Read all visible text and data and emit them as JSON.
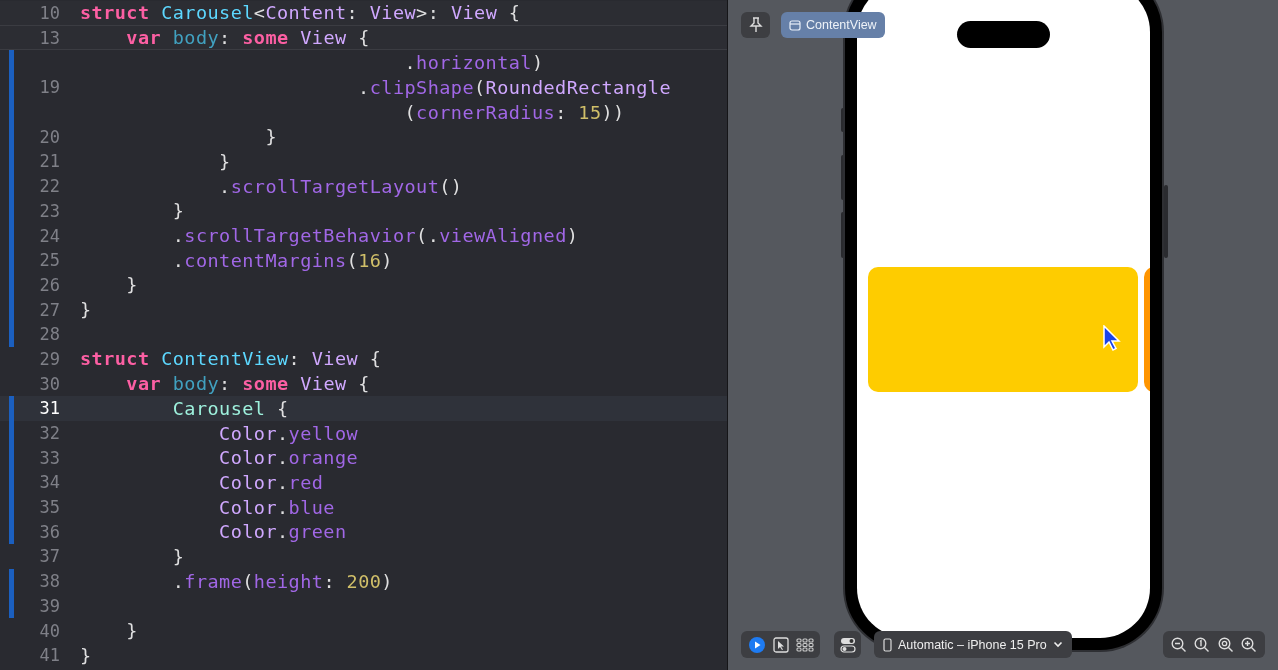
{
  "editor": {
    "lines": [
      {
        "number": "10",
        "sticky": true,
        "current": false,
        "changed": false,
        "tokens": [
          {
            "kind": "kw",
            "text": "struct "
          },
          {
            "kind": "decl",
            "text": "Carousel"
          },
          {
            "kind": "plain",
            "text": "<"
          },
          {
            "kind": "type",
            "text": "Content"
          },
          {
            "kind": "plain",
            "text": ": "
          },
          {
            "kind": "type",
            "text": "View"
          },
          {
            "kind": "plain",
            "text": ">: "
          },
          {
            "kind": "type",
            "text": "View"
          },
          {
            "kind": "plain",
            "text": " {"
          }
        ]
      },
      {
        "number": "13",
        "sticky": true,
        "current": false,
        "changed": false,
        "tokens": [
          {
            "kind": "kw",
            "text": "    var"
          },
          {
            "kind": "prop",
            "text": " body"
          },
          {
            "kind": "plain",
            "text": ": "
          },
          {
            "kind": "kw",
            "text": "some"
          },
          {
            "kind": "type",
            "text": " View"
          },
          {
            "kind": "plain",
            "text": " {"
          }
        ]
      },
      {
        "sticky": false,
        "current": false,
        "changed": true,
        "tokens": [
          {
            "kind": "plain",
            "text": "                            ."
          },
          {
            "kind": "method",
            "text": "horizontal"
          },
          {
            "kind": "plain",
            "text": ")"
          }
        ]
      },
      {
        "number": "19",
        "sticky": false,
        "current": false,
        "changed": true,
        "tokens": [
          {
            "kind": "plain",
            "text": "                        ."
          },
          {
            "kind": "method",
            "text": "clipShape"
          },
          {
            "kind": "plain",
            "text": "("
          },
          {
            "kind": "type",
            "text": "RoundedRectangle"
          }
        ]
      },
      {
        "sticky": false,
        "current": false,
        "changed": true,
        "tokens": [
          {
            "kind": "plain",
            "text": "                            ("
          },
          {
            "kind": "method",
            "text": "cornerRadius"
          },
          {
            "kind": "plain",
            "text": ": "
          },
          {
            "kind": "num",
            "text": "15"
          },
          {
            "kind": "plain",
            "text": "))"
          }
        ]
      },
      {
        "number": "20",
        "sticky": false,
        "current": false,
        "changed": true,
        "tokens": [
          {
            "kind": "plain",
            "text": "                }"
          }
        ]
      },
      {
        "number": "21",
        "sticky": false,
        "current": false,
        "changed": true,
        "tokens": [
          {
            "kind": "plain",
            "text": "            }"
          }
        ]
      },
      {
        "number": "22",
        "sticky": false,
        "current": false,
        "changed": true,
        "tokens": [
          {
            "kind": "plain",
            "text": "            ."
          },
          {
            "kind": "method",
            "text": "scrollTargetLayout"
          },
          {
            "kind": "plain",
            "text": "()"
          }
        ]
      },
      {
        "number": "23",
        "sticky": false,
        "current": false,
        "changed": true,
        "tokens": [
          {
            "kind": "plain",
            "text": "        }"
          }
        ]
      },
      {
        "number": "24",
        "sticky": false,
        "current": false,
        "changed": true,
        "tokens": [
          {
            "kind": "plain",
            "text": "        ."
          },
          {
            "kind": "method",
            "text": "scrollTargetBehavior"
          },
          {
            "kind": "plain",
            "text": "(."
          },
          {
            "kind": "method",
            "text": "viewAligned"
          },
          {
            "kind": "plain",
            "text": ")"
          }
        ]
      },
      {
        "number": "25",
        "sticky": false,
        "current": false,
        "changed": true,
        "tokens": [
          {
            "kind": "plain",
            "text": "        ."
          },
          {
            "kind": "method",
            "text": "contentMargins"
          },
          {
            "kind": "plain",
            "text": "("
          },
          {
            "kind": "num",
            "text": "16"
          },
          {
            "kind": "plain",
            "text": ")"
          }
        ]
      },
      {
        "number": "26",
        "sticky": false,
        "current": false,
        "changed": true,
        "tokens": [
          {
            "kind": "plain",
            "text": "    }"
          }
        ]
      },
      {
        "number": "27",
        "sticky": false,
        "current": false,
        "changed": true,
        "tokens": [
          {
            "kind": "plain",
            "text": "}"
          }
        ]
      },
      {
        "number": "28",
        "sticky": false,
        "current": false,
        "changed": true
      },
      {
        "number": "29",
        "sticky": false,
        "current": false,
        "changed": false,
        "tokens": [
          {
            "kind": "kw",
            "text": "struct "
          },
          {
            "kind": "decl",
            "text": "ContentView"
          },
          {
            "kind": "plain",
            "text": ": "
          },
          {
            "kind": "type",
            "text": "View"
          },
          {
            "kind": "plain",
            "text": " {"
          }
        ]
      },
      {
        "number": "30",
        "sticky": false,
        "current": false,
        "changed": false,
        "tokens": [
          {
            "kind": "kw",
            "text": "    var"
          },
          {
            "kind": "prop",
            "text": " body"
          },
          {
            "kind": "plain",
            "text": ": "
          },
          {
            "kind": "kw",
            "text": "some"
          },
          {
            "kind": "type",
            "text": " View"
          },
          {
            "kind": "plain",
            "text": " {"
          }
        ]
      },
      {
        "number": "31",
        "sticky": false,
        "current": true,
        "changed": true,
        "tokens": [
          {
            "kind": "projtype",
            "text": "        Carousel"
          },
          {
            "kind": "plain",
            "text": " {"
          }
        ]
      },
      {
        "number": "32",
        "sticky": false,
        "current": false,
        "changed": true,
        "tokens": [
          {
            "kind": "type",
            "text": "            Color"
          },
          {
            "kind": "plain",
            "text": "."
          },
          {
            "kind": "method",
            "text": "yellow"
          }
        ]
      },
      {
        "number": "33",
        "sticky": false,
        "current": false,
        "changed": true,
        "tokens": [
          {
            "kind": "type",
            "text": "            Color"
          },
          {
            "kind": "plain",
            "text": "."
          },
          {
            "kind": "method",
            "text": "orange"
          }
        ]
      },
      {
        "number": "34",
        "sticky": false,
        "current": false,
        "changed": true,
        "tokens": [
          {
            "kind": "type",
            "text": "            Color"
          },
          {
            "kind": "plain",
            "text": "."
          },
          {
            "kind": "method",
            "text": "red"
          }
        ]
      },
      {
        "number": "35",
        "sticky": false,
        "current": false,
        "changed": true,
        "tokens": [
          {
            "kind": "type",
            "text": "            Color"
          },
          {
            "kind": "plain",
            "text": "."
          },
          {
            "kind": "method",
            "text": "blue"
          }
        ]
      },
      {
        "number": "36",
        "sticky": false,
        "current": false,
        "changed": true,
        "tokens": [
          {
            "kind": "type",
            "text": "            Color"
          },
          {
            "kind": "plain",
            "text": "."
          },
          {
            "kind": "method",
            "text": "green"
          }
        ]
      },
      {
        "number": "37",
        "sticky": false,
        "current": false,
        "changed": false,
        "tokens": [
          {
            "kind": "plain",
            "text": "        }"
          }
        ]
      },
      {
        "number": "38",
        "sticky": false,
        "current": false,
        "changed": true,
        "tokens": [
          {
            "kind": "plain",
            "text": "        ."
          },
          {
            "kind": "method",
            "text": "frame"
          },
          {
            "kind": "plain",
            "text": "("
          },
          {
            "kind": "method",
            "text": "height"
          },
          {
            "kind": "plain",
            "text": ": "
          },
          {
            "kind": "num",
            "text": "200"
          },
          {
            "kind": "plain",
            "text": ")"
          }
        ]
      },
      {
        "number": "39",
        "sticky": false,
        "current": false,
        "changed": true
      },
      {
        "number": "40",
        "sticky": false,
        "current": false,
        "changed": false,
        "tokens": [
          {
            "kind": "plain",
            "text": "    }"
          }
        ]
      },
      {
        "number": "41",
        "sticky": false,
        "current": false,
        "changed": false,
        "tokens": [
          {
            "kind": "plain",
            "text": "}"
          }
        ]
      }
    ]
  },
  "preview": {
    "tab": {
      "label": "ContentView",
      "selected": true
    },
    "cards": [
      {
        "color": "#fecc00"
      },
      {
        "color": "#ff9500"
      }
    ],
    "modes": [
      {
        "kind": "live",
        "selected": true
      },
      {
        "kind": "select",
        "selected": false
      },
      {
        "kind": "variants",
        "selected": false
      }
    ],
    "device": "Automatic – iPhone 15 Pro"
  }
}
